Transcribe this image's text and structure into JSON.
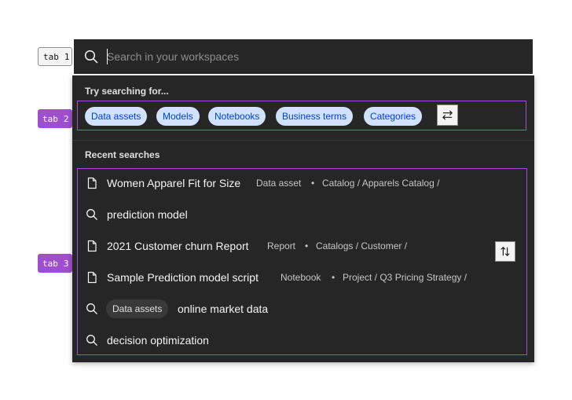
{
  "tab_markers": [
    {
      "label": "tab",
      "number": "1"
    },
    {
      "label": "tab",
      "number": "2"
    },
    {
      "label": "tab",
      "number": "3"
    }
  ],
  "search": {
    "placeholder": "Search in your workspaces",
    "value": ""
  },
  "suggestions": {
    "heading": "Try searching for...",
    "tags": [
      "Data assets",
      "Models",
      "Notebooks",
      "Business terms",
      "Categories"
    ]
  },
  "recent": {
    "heading": "Recent searches",
    "items": [
      {
        "icon": "document-icon",
        "title": "Women Apparel Fit for Size",
        "type": "Data asset",
        "path": "Catalog / Apparels Catalog /"
      },
      {
        "icon": "search-icon",
        "title": "prediction model"
      },
      {
        "icon": "document-icon",
        "title": "2021 Customer churn Report",
        "type": "Report",
        "path": "Catalogs / Customer /"
      },
      {
        "icon": "document-icon",
        "title": "Sample Prediction model script",
        "type": "Notebook",
        "path": "Project / Q3 Pricing Strategy /"
      },
      {
        "icon": "search-icon",
        "chip": "Data assets",
        "title": "online market data"
      },
      {
        "icon": "search-icon",
        "title": "decision optimization"
      }
    ]
  },
  "colors": {
    "background": "#262626",
    "focus_outline": "#a04ed0",
    "tag_background": "#d0e2ff",
    "tag_text": "#0043ce",
    "text_primary": "#f4f4f4"
  }
}
